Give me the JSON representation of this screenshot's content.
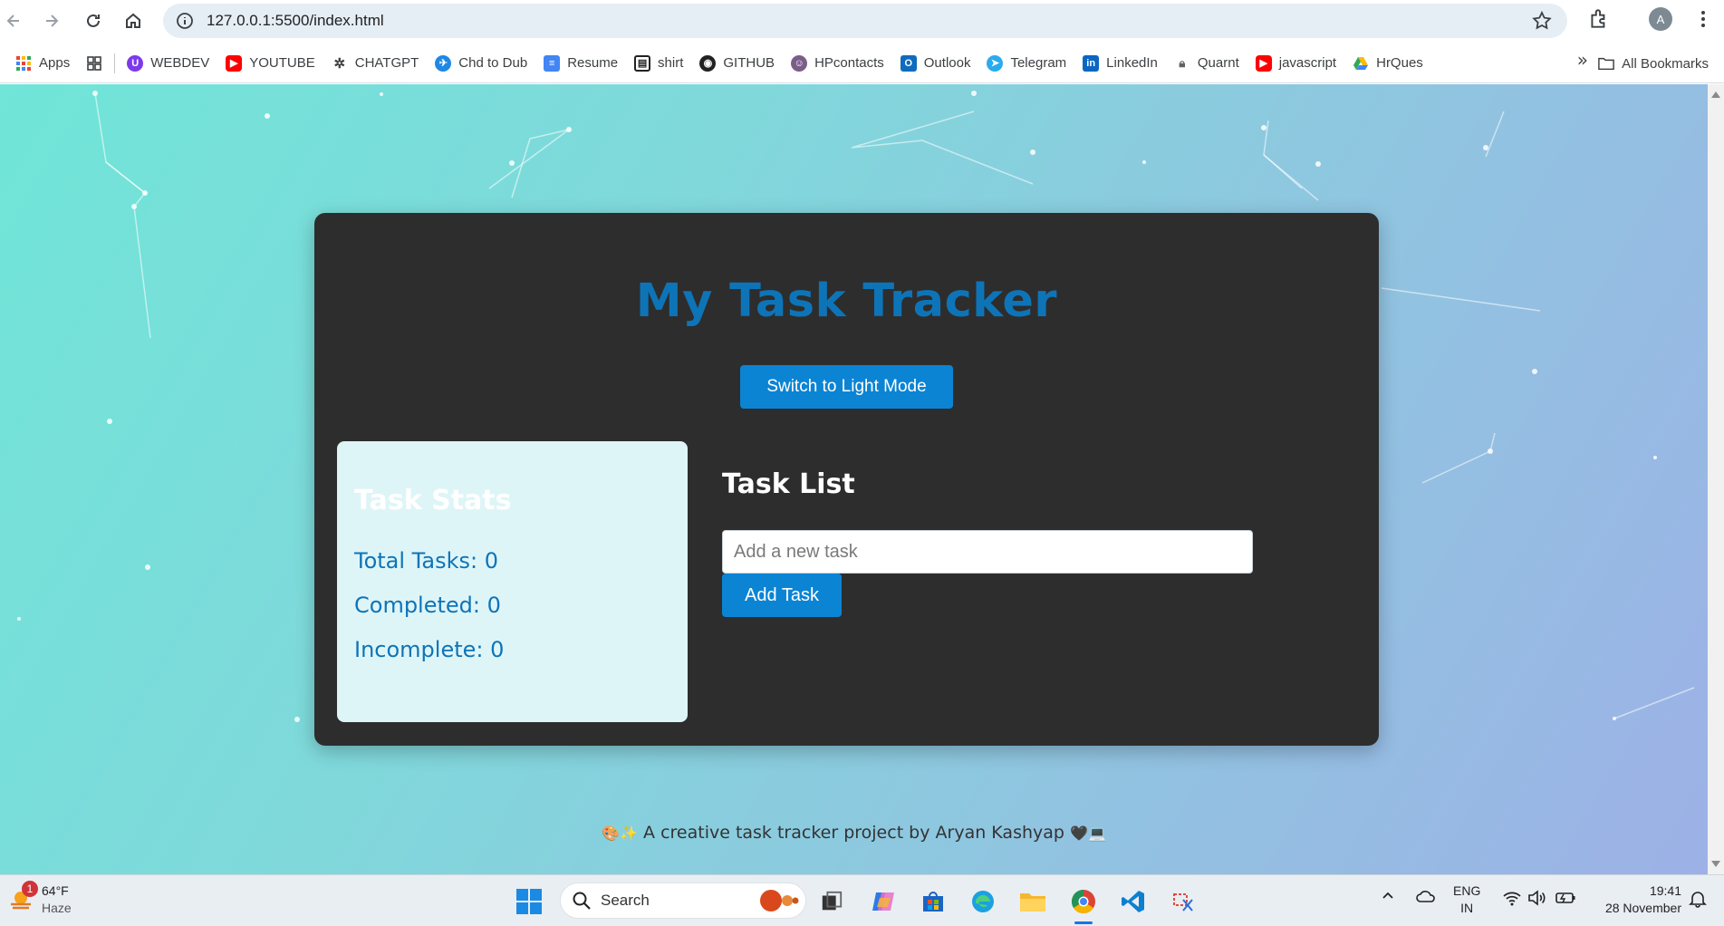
{
  "browser": {
    "url": "127.0.0.1:5500/index.html",
    "profile_initial": "A",
    "bookmarks": [
      {
        "label": "Apps",
        "icon": "apps-grid-icon",
        "color": "#ea4335"
      },
      {
        "label": "",
        "icon": "tab-groups-icon",
        "color": "#3c4043"
      },
      {
        "label": "WEBDEV",
        "icon": "webdev-icon",
        "color": "#7c3aed"
      },
      {
        "label": "YOUTUBE",
        "icon": "youtube-icon",
        "color": "#ff0000"
      },
      {
        "label": "CHATGPT",
        "icon": "chatgpt-icon",
        "color": "#3c4043"
      },
      {
        "label": "Chd to Dub",
        "icon": "plane-icon",
        "color": "#1e88e5"
      },
      {
        "label": "Resume",
        "icon": "docs-icon",
        "color": "#4285f4"
      },
      {
        "label": "shirt",
        "icon": "shirt-icon",
        "color": "#222222"
      },
      {
        "label": "GITHUB",
        "icon": "github-icon",
        "color": "#222222"
      },
      {
        "label": "HPcontacts",
        "icon": "contacts-icon",
        "color": "#7b5d8a"
      },
      {
        "label": "Outlook",
        "icon": "outlook-icon",
        "color": "#0f6cbd"
      },
      {
        "label": "Telegram",
        "icon": "telegram-icon",
        "color": "#2aabee"
      },
      {
        "label": "LinkedIn",
        "icon": "linkedin-icon",
        "color": "#0a66c2"
      },
      {
        "label": "Quarnt",
        "icon": "lock-icon",
        "color": "#5f6368"
      },
      {
        "label": "javascript",
        "icon": "youtube-icon",
        "color": "#ff0000"
      },
      {
        "label": "HrQues",
        "icon": "drive-icon",
        "color": "#34a853"
      }
    ],
    "all_bookmarks_label": "All Bookmarks"
  },
  "page": {
    "title": "My Task Tracker",
    "theme_button": "Switch to Light Mode",
    "stats": {
      "heading": "Task Stats",
      "total": "Total Tasks: 0",
      "completed": "Completed: 0",
      "incomplete": "Incomplete: 0"
    },
    "tasks": {
      "heading": "Task List",
      "input_placeholder": "Add a new task",
      "add_button": "Add Task"
    },
    "footer": {
      "emoji_left": "🎨✨",
      "text": "A creative task tracker project by Aryan Kashyap",
      "emoji_right": "🖤💻"
    }
  },
  "taskbar": {
    "weather_temp": "64°F",
    "weather_cond": "Haze",
    "weather_badge": "1",
    "search_label": "Search",
    "lang_top": "ENG",
    "lang_bottom": "IN",
    "time": "19:41",
    "date": "28 November"
  },
  "colors": {
    "accent": "#0b84d4",
    "title": "#0e74b8",
    "card": "#2d2d2d",
    "stats_bg": "#def5f7"
  }
}
